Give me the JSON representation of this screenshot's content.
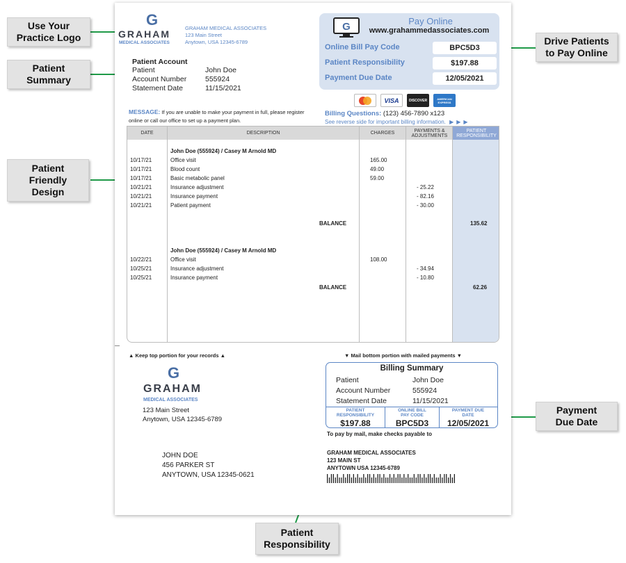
{
  "callouts": {
    "logo": "Use Your\nPractice Logo",
    "summary": "Patient\nSummary",
    "friendly": "Patient\nFriendly\nDesign",
    "responsibility": "Patient\nResponsibility",
    "drive": "Drive Patients\nto Pay Online",
    "due": "Payment\nDue Date"
  },
  "practice": {
    "logo_letter": "G",
    "brand": "GRAHAM",
    "subbrand": "MEDICAL ASSOCIATES",
    "name": "GRAHAM MEDICAL ASSOCIATES",
    "street": "123 Main Street",
    "city": "Anytown, USA 12345-6789"
  },
  "account": {
    "title": "Patient Account",
    "rows": [
      {
        "label": "Patient",
        "value": "John Doe"
      },
      {
        "label": "Account Number",
        "value": "555924"
      },
      {
        "label": "Statement Date",
        "value": "11/15/2021"
      }
    ]
  },
  "pay_online": {
    "title": "Pay Online",
    "url": "www.grahammedassociates.com",
    "rows": [
      {
        "label": "Online Bill Pay Code",
        "value": "BPC5D3"
      },
      {
        "label": "Patient Responsibility",
        "value": "$197.88"
      },
      {
        "label": "Payment Due Date",
        "value": "12/05/2021"
      }
    ]
  },
  "cards": [
    "MasterCard",
    "VISA",
    "DISCOVER",
    "AMERICAN EXPRESS"
  ],
  "billing": {
    "label": "Billing Questions:",
    "phone": "(123) 456-7890 x123",
    "see_reverse": "See reverse side for important billing information."
  },
  "message": {
    "label": "MESSAGE:",
    "text": "If you are unable to make your payment in full, please register online or call our office to set up a payment plan."
  },
  "table": {
    "headers": [
      "DATE",
      "DESCRIPTION",
      "CHARGES",
      "PAYMENTS & ADJUSTMENTS",
      "PATIENT RESPONSIBILITY"
    ],
    "groups": [
      {
        "heading": "John Doe (555924) / Casey M Arnold MD",
        "rows": [
          {
            "date": "10/17/21",
            "desc": "Office visit",
            "charge": "165.00",
            "adj": ""
          },
          {
            "date": "10/17/21",
            "desc": "Blood count",
            "charge": "49.00",
            "adj": ""
          },
          {
            "date": "10/17/21",
            "desc": "Basic metabolic panel",
            "charge": "59.00",
            "adj": ""
          },
          {
            "date": "10/21/21",
            "desc": "Insurance adjustment",
            "charge": "",
            "adj": "- 25.22"
          },
          {
            "date": "10/21/21",
            "desc": "Insurance payment",
            "charge": "",
            "adj": "- 82.16"
          },
          {
            "date": "10/21/21",
            "desc": "Patient payment",
            "charge": "",
            "adj": "- 30.00"
          }
        ],
        "balance_label": "BALANCE",
        "balance": "135.62"
      },
      {
        "heading": "John Doe (555924) / Casey M Arnold MD",
        "rows": [
          {
            "date": "10/22/21",
            "desc": "Office visit",
            "charge": "108.00",
            "adj": ""
          },
          {
            "date": "10/25/21",
            "desc": "Insurance adjustment",
            "charge": "",
            "adj": "- 34.94"
          },
          {
            "date": "10/25/21",
            "desc": "Insurance payment",
            "charge": "",
            "adj": "- 10.80"
          }
        ],
        "balance_label": "BALANCE",
        "balance": "62.26"
      }
    ]
  },
  "stub": {
    "keep_top": "Keep top portion for your records",
    "mail_bottom": "Mail bottom portion with mailed payments",
    "street": "123 Main Street",
    "city": "Anytown, USA 12345-6789"
  },
  "billing_summary": {
    "title": "Billing Summary",
    "rows": [
      {
        "label": "Patient",
        "value": "John Doe"
      },
      {
        "label": "Account Number",
        "value": "555924"
      },
      {
        "label": "Statement Date",
        "value": "11/15/2021"
      }
    ],
    "cols": [
      {
        "label": "PATIENT\nRESPONSIBILITY",
        "value": "$197.88"
      },
      {
        "label": "ONLINE BILL\nPAY CODE",
        "value": "BPC5D3"
      },
      {
        "label": "PAYMENT DUE\nDATE",
        "value": "12/05/2021"
      }
    ]
  },
  "pay_by_mail": "To pay by mail, make checks payable to",
  "remit_to": [
    "GRAHAM MEDICAL ASSOCIATES",
    "123 MAIN ST",
    "ANYTOWN USA  12345-6789"
  ],
  "recipient": [
    "JOHN DOE",
    "456 PARKER ST",
    "ANYTOWN, USA 12345-0621"
  ],
  "colors": {
    "accent": "#5b86c5",
    "panel": "#d8e2f0",
    "arrow": "#1f9a48"
  }
}
